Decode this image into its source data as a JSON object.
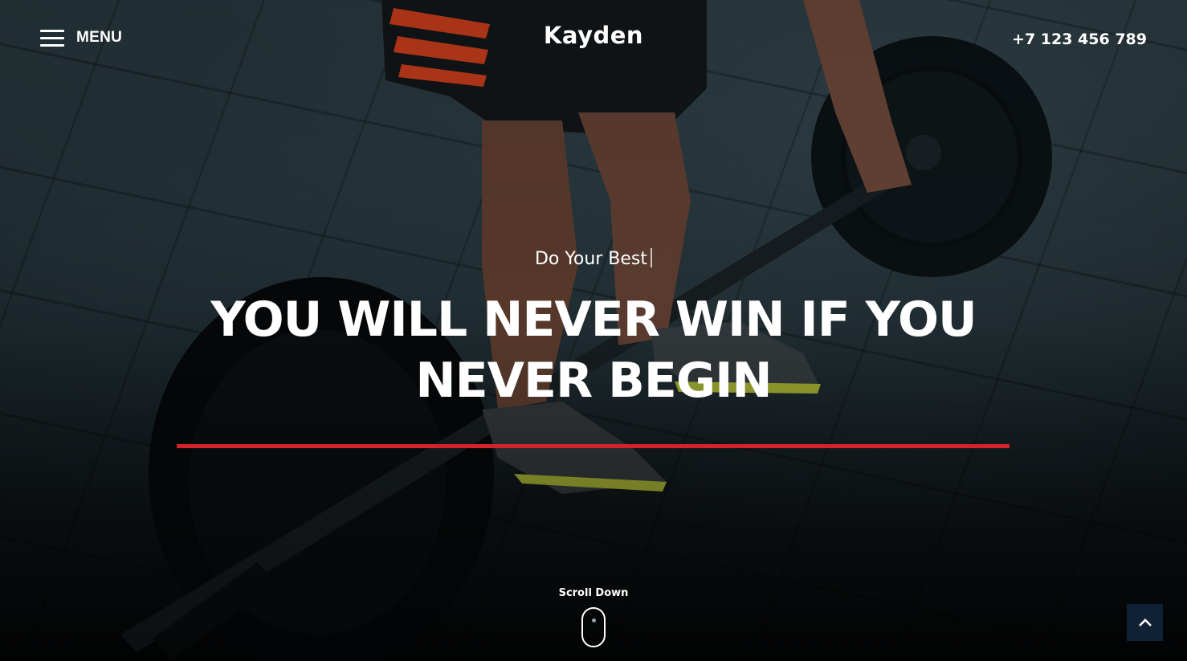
{
  "header": {
    "menu_label": "MENU",
    "logo": "Kayden",
    "phone": "+7 123 456 789"
  },
  "hero": {
    "tagline": "Do Your Best",
    "headline": "YOU WILL NEVER WIN IF YOU NEVER BEGIN",
    "accent_color": "#d3242b"
  },
  "scroll": {
    "label": "Scroll Down"
  },
  "icons": {
    "menu": "hamburger-icon",
    "scroll": "mouse-icon",
    "back_to_top": "chevron-up-icon"
  },
  "colors": {
    "back_to_top_bg": "#0f2235",
    "text": "#ffffff"
  }
}
